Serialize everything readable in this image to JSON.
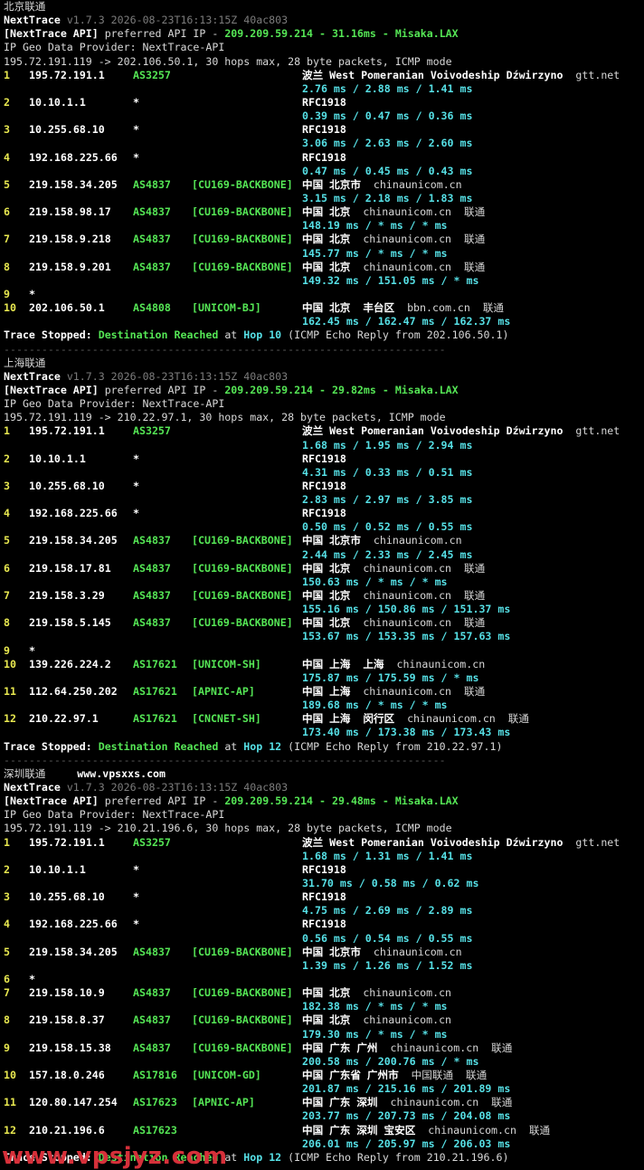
{
  "sections": [
    {
      "title": "北京联通",
      "website": "",
      "tool": "NextTrace",
      "version": "v1.7.3 2026-08-23T16:13:15Z 40ac803",
      "api_prefix": "[NextTrace API]",
      "api_text": "preferred API IP -",
      "api_ip": "209.209.59.214",
      "api_latency": "31.16ms",
      "api_site": "Misaka.LAX",
      "geo_provider": "IP Geo Data Provider: NextTrace-API",
      "route": "195.72.191.119 -> 202.106.50.1, 30 hops max, 28 byte packets, ICMP mode",
      "hops": [
        {
          "n": "1",
          "ip": "195.72.191.1",
          "as": "AS3257",
          "tag": "",
          "geo": "波兰 West Pomeranian Voivodeship Dźwirzyno",
          "rdns": "gtt.net",
          "isp": "",
          "rtt": "2.76 ms / 2.88 ms / 1.41 ms"
        },
        {
          "n": "2",
          "ip": "10.10.1.1",
          "as": "*",
          "tag": "",
          "geo": "RFC1918",
          "rdns": "",
          "isp": "",
          "rtt": "0.39 ms / 0.47 ms / 0.36 ms"
        },
        {
          "n": "3",
          "ip": "10.255.68.10",
          "as": "*",
          "tag": "",
          "geo": "RFC1918",
          "rdns": "",
          "isp": "",
          "rtt": "3.06 ms / 2.63 ms / 2.60 ms"
        },
        {
          "n": "4",
          "ip": "192.168.225.66",
          "as": "*",
          "tag": "",
          "geo": "RFC1918",
          "rdns": "",
          "isp": "",
          "rtt": "0.47 ms / 0.45 ms / 0.43 ms"
        },
        {
          "n": "5",
          "ip": "219.158.34.205",
          "as": "AS4837",
          "tag": "[CU169-BACKBONE]",
          "geo": "中国 北京市",
          "rdns": "chinaunicom.cn",
          "isp": "",
          "rtt": "3.15 ms / 2.18 ms / 1.83 ms"
        },
        {
          "n": "6",
          "ip": "219.158.98.17",
          "as": "AS4837",
          "tag": "[CU169-BACKBONE]",
          "geo": "中国 北京",
          "rdns": "chinaunicom.cn",
          "isp": "联通",
          "rtt": "148.19 ms / * ms / * ms"
        },
        {
          "n": "7",
          "ip": "219.158.9.218",
          "as": "AS4837",
          "tag": "[CU169-BACKBONE]",
          "geo": "中国 北京",
          "rdns": "chinaunicom.cn",
          "isp": "联通",
          "rtt": "145.77 ms / * ms / * ms"
        },
        {
          "n": "8",
          "ip": "219.158.9.201",
          "as": "AS4837",
          "tag": "[CU169-BACKBONE]",
          "geo": "中国 北京",
          "rdns": "chinaunicom.cn",
          "isp": "联通",
          "rtt": "149.32 ms / 151.05 ms / * ms"
        },
        {
          "n": "9",
          "ip": "*",
          "as": "",
          "tag": "",
          "geo": "",
          "rdns": "",
          "isp": "",
          "rtt": ""
        },
        {
          "n": "10",
          "ip": "202.106.50.1",
          "as": "AS4808",
          "tag": "[UNICOM-BJ]",
          "geo": "中国 北京  丰台区",
          "rdns": "bbn.com.cn",
          "isp": "联通",
          "rtt": "162.45 ms / 162.47 ms / 162.37 ms"
        }
      ],
      "stop_label": "Trace Stopped:",
      "stop_dest": "Destination Reached",
      "stop_at": "at",
      "stop_hop": "Hop 10",
      "stop_rest": "(ICMP Echo Reply from 202.106.50.1)",
      "separator": "----------------------------------------------------------------------"
    },
    {
      "title": "上海联通",
      "website": "",
      "tool": "NextTrace",
      "version": "v1.7.3 2026-08-23T16:13:15Z 40ac803",
      "api_prefix": "[NextTrace API]",
      "api_text": "preferred API IP -",
      "api_ip": "209.209.59.214",
      "api_latency": "29.82ms",
      "api_site": "Misaka.LAX",
      "geo_provider": "IP Geo Data Provider: NextTrace-API",
      "route": "195.72.191.119 -> 210.22.97.1, 30 hops max, 28 byte packets, ICMP mode",
      "hops": [
        {
          "n": "1",
          "ip": "195.72.191.1",
          "as": "AS3257",
          "tag": "",
          "geo": "波兰 West Pomeranian Voivodeship Dźwirzyno",
          "rdns": "gtt.net",
          "isp": "",
          "rtt": "1.68 ms / 1.95 ms / 2.94 ms"
        },
        {
          "n": "2",
          "ip": "10.10.1.1",
          "as": "*",
          "tag": "",
          "geo": "RFC1918",
          "rdns": "",
          "isp": "",
          "rtt": "4.31 ms / 0.33 ms / 0.51 ms"
        },
        {
          "n": "3",
          "ip": "10.255.68.10",
          "as": "*",
          "tag": "",
          "geo": "RFC1918",
          "rdns": "",
          "isp": "",
          "rtt": "2.83 ms / 2.97 ms / 3.85 ms"
        },
        {
          "n": "4",
          "ip": "192.168.225.66",
          "as": "*",
          "tag": "",
          "geo": "RFC1918",
          "rdns": "",
          "isp": "",
          "rtt": "0.50 ms / 0.52 ms / 0.55 ms"
        },
        {
          "n": "5",
          "ip": "219.158.34.205",
          "as": "AS4837",
          "tag": "[CU169-BACKBONE]",
          "geo": "中国 北京市",
          "rdns": "chinaunicom.cn",
          "isp": "",
          "rtt": "2.44 ms / 2.33 ms / 2.45 ms"
        },
        {
          "n": "6",
          "ip": "219.158.17.81",
          "as": "AS4837",
          "tag": "[CU169-BACKBONE]",
          "geo": "中国 北京",
          "rdns": "chinaunicom.cn",
          "isp": "联通",
          "rtt": "150.63 ms / * ms / * ms"
        },
        {
          "n": "7",
          "ip": "219.158.3.29",
          "as": "AS4837",
          "tag": "[CU169-BACKBONE]",
          "geo": "中国 北京",
          "rdns": "chinaunicom.cn",
          "isp": "联通",
          "rtt": "155.16 ms / 150.86 ms / 151.37 ms"
        },
        {
          "n": "8",
          "ip": "219.158.5.145",
          "as": "AS4837",
          "tag": "[CU169-BACKBONE]",
          "geo": "中国 北京",
          "rdns": "chinaunicom.cn",
          "isp": "联通",
          "rtt": "153.67 ms / 153.35 ms / 157.63 ms"
        },
        {
          "n": "9",
          "ip": "*",
          "as": "",
          "tag": "",
          "geo": "",
          "rdns": "",
          "isp": "",
          "rtt": ""
        },
        {
          "n": "10",
          "ip": "139.226.224.2",
          "as": "AS17621",
          "tag": "[UNICOM-SH]",
          "geo": "中国 上海  上海",
          "rdns": "chinaunicom.cn",
          "isp": "",
          "rtt": "175.87 ms / 175.59 ms / * ms"
        },
        {
          "n": "11",
          "ip": "112.64.250.202",
          "as": "AS17621",
          "tag": "[APNIC-AP]",
          "geo": "中国 上海",
          "rdns": "chinaunicom.cn",
          "isp": "联通",
          "rtt": "189.68 ms / * ms / * ms"
        },
        {
          "n": "12",
          "ip": "210.22.97.1",
          "as": "AS17621",
          "tag": "[CNCNET-SH]",
          "geo": "中国 上海  闵行区",
          "rdns": "chinaunicom.cn",
          "isp": "联通",
          "rtt": "173.40 ms / 173.38 ms / 173.43 ms"
        }
      ],
      "stop_label": "Trace Stopped:",
      "stop_dest": "Destination Reached",
      "stop_at": "at",
      "stop_hop": "Hop 12",
      "stop_rest": "(ICMP Echo Reply from 210.22.97.1)",
      "separator": "----------------------------------------------------------------------"
    },
    {
      "title": "深圳联通",
      "website": "www.vpsxxs.com",
      "tool": "NextTrace",
      "version": "v1.7.3 2026-08-23T16:13:15Z 40ac803",
      "api_prefix": "[NextTrace API]",
      "api_text": "preferred API IP -",
      "api_ip": "209.209.59.214",
      "api_latency": "29.48ms",
      "api_site": "Misaka.LAX",
      "geo_provider": "IP Geo Data Provider: NextTrace-API",
      "route": "195.72.191.119 -> 210.21.196.6, 30 hops max, 28 byte packets, ICMP mode",
      "hops": [
        {
          "n": "1",
          "ip": "195.72.191.1",
          "as": "AS3257",
          "tag": "",
          "geo": "波兰 West Pomeranian Voivodeship Dźwirzyno",
          "rdns": "gtt.net",
          "isp": "",
          "rtt": "1.68 ms / 1.31 ms / 1.41 ms"
        },
        {
          "n": "2",
          "ip": "10.10.1.1",
          "as": "*",
          "tag": "",
          "geo": "RFC1918",
          "rdns": "",
          "isp": "",
          "rtt": "31.70 ms / 0.58 ms / 0.62 ms"
        },
        {
          "n": "3",
          "ip": "10.255.68.10",
          "as": "*",
          "tag": "",
          "geo": "RFC1918",
          "rdns": "",
          "isp": "",
          "rtt": "4.75 ms / 2.69 ms / 2.89 ms"
        },
        {
          "n": "4",
          "ip": "192.168.225.66",
          "as": "*",
          "tag": "",
          "geo": "RFC1918",
          "rdns": "",
          "isp": "",
          "rtt": "0.56 ms / 0.54 ms / 0.55 ms"
        },
        {
          "n": "5",
          "ip": "219.158.34.205",
          "as": "AS4837",
          "tag": "[CU169-BACKBONE]",
          "geo": "中国 北京市",
          "rdns": "chinaunicom.cn",
          "isp": "",
          "rtt": "1.39 ms / 1.26 ms / 1.52 ms"
        },
        {
          "n": "6",
          "ip": "*",
          "as": "",
          "tag": "",
          "geo": "",
          "rdns": "",
          "isp": "",
          "rtt": ""
        },
        {
          "n": "7",
          "ip": "219.158.10.9",
          "as": "AS4837",
          "tag": "[CU169-BACKBONE]",
          "geo": "中国 北京",
          "rdns": "chinaunicom.cn",
          "isp": "",
          "rtt": "182.38 ms / * ms / * ms"
        },
        {
          "n": "8",
          "ip": "219.158.8.37",
          "as": "AS4837",
          "tag": "[CU169-BACKBONE]",
          "geo": "中国 北京",
          "rdns": "chinaunicom.cn",
          "isp": "",
          "rtt": "179.30 ms / * ms / * ms"
        },
        {
          "n": "9",
          "ip": "219.158.15.38",
          "as": "AS4837",
          "tag": "[CU169-BACKBONE]",
          "geo": "中国 广东 广州",
          "rdns": "chinaunicom.cn",
          "isp": "联通",
          "rtt": "200.58 ms / 200.76 ms / * ms"
        },
        {
          "n": "10",
          "ip": "157.18.0.246",
          "as": "AS17816",
          "tag": "[UNICOM-GD]",
          "geo": "中国 广东省 广州市",
          "rdns": "中国联通",
          "isp": "联通",
          "rtt": "201.87 ms / 215.16 ms / 201.89 ms"
        },
        {
          "n": "11",
          "ip": "120.80.147.254",
          "as": "AS17623",
          "tag": "[APNIC-AP]",
          "geo": "中国 广东 深圳",
          "rdns": "chinaunicom.cn",
          "isp": "联通",
          "rtt": "203.77 ms / 207.73 ms / 204.08 ms"
        },
        {
          "n": "12",
          "ip": "210.21.196.6",
          "as": "AS17623",
          "tag": "",
          "geo": "中国 广东 深圳 宝安区",
          "rdns": "chinaunicom.cn",
          "isp": "联通",
          "rtt": "206.01 ms / 205.97 ms / 206.03 ms"
        }
      ],
      "stop_label": "Trace Stopped:",
      "stop_dest": "Destination Reached",
      "stop_at": "at",
      "stop_hop": "Hop 12",
      "stop_rest": "(ICMP Echo Reply from 210.21.196.6)",
      "separator": ""
    }
  ],
  "watermark": "www.vpsjyz.com",
  "colors": {
    "background": "#000000",
    "text": "#d8d8d8",
    "as_number": "#55e655",
    "latency": "#56e0e6",
    "tag": "#e8e850",
    "watermark": "#d6303a"
  }
}
